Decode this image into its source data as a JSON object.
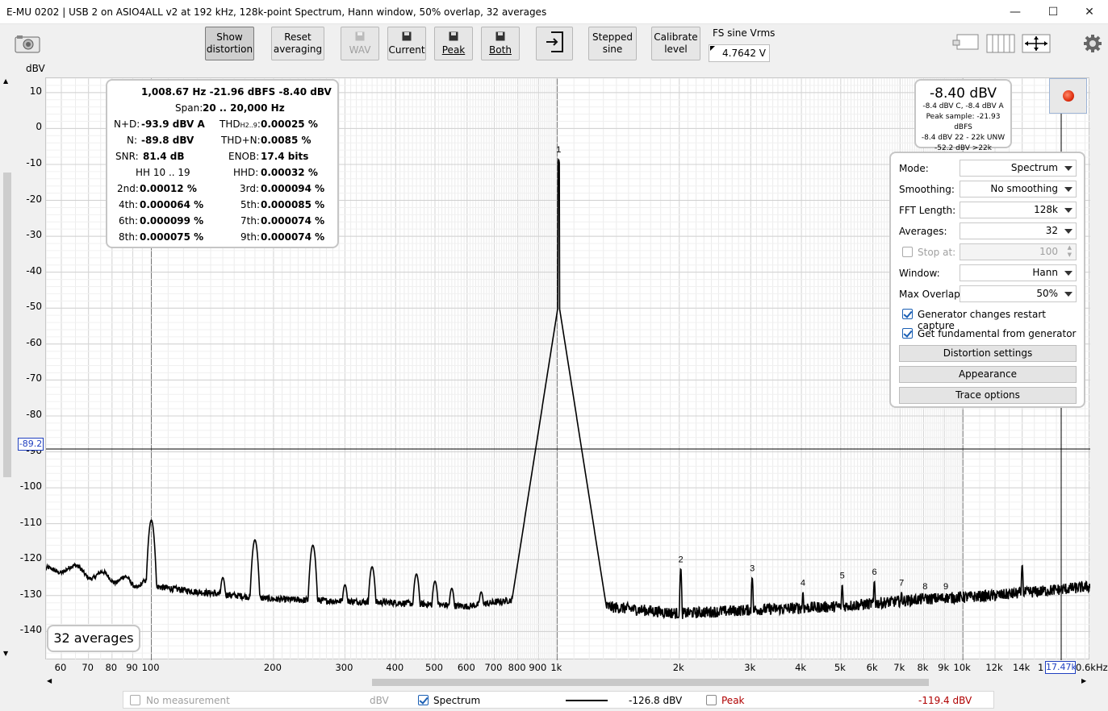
{
  "window": {
    "title": "E-MU 0202 | USB 2 on ASIO4ALL v2 at 192 kHz, 128k-point Spectrum, Hann window, 50% overlap, 32 averages",
    "minimize": "—",
    "maximize": "☐",
    "close": "✕"
  },
  "toolbar": {
    "show_distortion": [
      "Show",
      "distortion"
    ],
    "reset_averaging": [
      "Reset",
      "averaging"
    ],
    "wav": "WAV",
    "current": "Current",
    "peak": "Peak",
    "both": "Both",
    "stepped_sine": [
      "Stepped",
      "sine"
    ],
    "calibrate_level": [
      "Calibrate",
      "level"
    ],
    "fs_label": "FS sine Vrms",
    "fs_value": "4.7642 V"
  },
  "icons": {
    "camera": "camera-icon",
    "save": "save-icon",
    "export": "export-icon",
    "layout": "layout-icon",
    "columns": "columns-icon",
    "fit": "fit-arrows-icon",
    "gear": "gear-icon"
  },
  "info": {
    "header": "1,008.67 Hz  -21.96 dBFS  -8.40 dBV",
    "span_label": "Span:",
    "span_value": "20 .. 20,000 Hz",
    "nd_label": "N+D:",
    "nd_value": "-93.9 dBV A",
    "thd_label": "THD",
    "thd_sub": "H2..9",
    "thd_colon": ":",
    "thd_value": "0.00025 %",
    "n_label": "N:",
    "n_value": "-89.8 dBV",
    "thdn_label": "THD+N:",
    "thdn_value": "0.0085 %",
    "snr_label": "SNR:",
    "snr_value": "81.4 dB",
    "enob_label": "ENOB:",
    "enob_value": "17.4 bits",
    "hh_label": "HH 10 .. 19",
    "hhd_label": "HHD:",
    "hhd_value": "0.00032 %",
    "h2_label": "2nd:",
    "h2_value": "0.00012 %",
    "h3_label": "3rd:",
    "h3_value": "0.000094 %",
    "h4_label": "4th:",
    "h4_value": "0.000064 %",
    "h5_label": "5th:",
    "h5_value": "0.000085 %",
    "h6_label": "6th:",
    "h6_value": "0.000099 %",
    "h7_label": "7th:",
    "h7_value": "0.000074 %",
    "h8_label": "8th:",
    "h8_value": "0.000075 %",
    "h9_label": "9th:",
    "h9_value": "0.000074 %"
  },
  "level": {
    "main": "-8.40 dBV",
    "line1": "-8.4 dBV C, -8.4 dBV A",
    "line2": "Peak sample: -21.93 dBFS",
    "line3": "-8.4 dBV 22 - 22k UNW",
    "line4": "-52.2 dBV >22k"
  },
  "settings": {
    "mode_label": "Mode:",
    "mode_value": "Spectrum",
    "smoothing_label": "Smoothing:",
    "smoothing_value": "No smoothing",
    "fft_label": "FFT Length:",
    "fft_value": "128k",
    "averages_label": "Averages:",
    "averages_value": "32",
    "stop_label": "Stop at:",
    "stop_value": "100",
    "window_label": "Window:",
    "window_value": "Hann",
    "overlap_label": "Max Overlap:",
    "overlap_value": "50%",
    "gen_restart": "Generator changes restart capture",
    "get_fund": "Get fundamental from generator",
    "distortion_settings": "Distortion settings",
    "appearance": "Appearance",
    "trace_options": "Trace options"
  },
  "plot": {
    "y_unit": "dBV",
    "averages_badge": "32 averages",
    "cursor_y": "-89.2",
    "cursor_x": "17.47k",
    "x_tail_label": "0.6kHz",
    "x_partial_label": "1"
  },
  "legend": {
    "no_measurement": "No measurement",
    "unit": "dBV",
    "spectrum": "Spectrum",
    "spectrum_value": "-126.8 dBV",
    "peak": "Peak",
    "peak_value": "-119.4 dBV"
  },
  "chart_data": {
    "type": "line",
    "xscale": "log",
    "xlim": [
      55,
      20600
    ],
    "ylim": [
      -148,
      14
    ],
    "ylabel": "dBV",
    "y_ticks": [
      10,
      0,
      -10,
      -20,
      -30,
      -40,
      -50,
      -60,
      -70,
      -80,
      -90,
      -100,
      -110,
      -120,
      -130,
      -140
    ],
    "x_ticks": [
      {
        "v": 60,
        "t": "60"
      },
      {
        "v": 70,
        "t": "70"
      },
      {
        "v": 80,
        "t": "80"
      },
      {
        "v": 90,
        "t": "90"
      },
      {
        "v": 100,
        "t": "100"
      },
      {
        "v": 200,
        "t": "200"
      },
      {
        "v": 300,
        "t": "300"
      },
      {
        "v": 400,
        "t": "400"
      },
      {
        "v": 500,
        "t": "500"
      },
      {
        "v": 600,
        "t": "600"
      },
      {
        "v": 700,
        "t": "700"
      },
      {
        "v": 800,
        "t": "800"
      },
      {
        "v": 900,
        "t": "900"
      },
      {
        "v": 1000,
        "t": "1k"
      },
      {
        "v": 2000,
        "t": "2k"
      },
      {
        "v": 3000,
        "t": "3k"
      },
      {
        "v": 4000,
        "t": "4k"
      },
      {
        "v": 5000,
        "t": "5k"
      },
      {
        "v": 6000,
        "t": "6k"
      },
      {
        "v": 7000,
        "t": "7k"
      },
      {
        "v": 8000,
        "t": "8k"
      },
      {
        "v": 9000,
        "t": "9k"
      },
      {
        "v": 10000,
        "t": "10k"
      },
      {
        "v": 12000,
        "t": "12k"
      },
      {
        "v": 14000,
        "t": "14k"
      }
    ],
    "series": [
      {
        "name": "Spectrum",
        "color": "#000000",
        "floor": [
          [
            55,
            -123.5
          ],
          [
            62,
            -122
          ],
          [
            70,
            -124
          ],
          [
            80,
            -125
          ],
          [
            95,
            -127
          ],
          [
            130,
            -129
          ],
          [
            200,
            -131
          ],
          [
            400,
            -132
          ],
          [
            600,
            -133
          ],
          [
            800,
            -131
          ],
          [
            900,
            -128
          ],
          [
            1300,
            -133
          ],
          [
            2000,
            -135
          ],
          [
            3000,
            -134
          ],
          [
            5000,
            -133
          ],
          [
            8000,
            -131
          ],
          [
            12000,
            -130
          ],
          [
            20600,
            -127.5
          ]
        ],
        "peaks": [
          {
            "f": 100,
            "db": -109
          },
          {
            "f": 150,
            "db": -125
          },
          {
            "f": 180,
            "db": -114.5
          },
          {
            "f": 250,
            "db": -116
          },
          {
            "f": 300,
            "db": -127
          },
          {
            "f": 350,
            "db": -122
          },
          {
            "f": 450,
            "db": -124
          },
          {
            "f": 500,
            "db": -126
          },
          {
            "f": 550,
            "db": -128
          },
          {
            "f": 650,
            "db": -129
          },
          {
            "f": 2017,
            "db": -122.5
          },
          {
            "f": 3026,
            "db": -125
          },
          {
            "f": 4035,
            "db": -129
          },
          {
            "f": 5043,
            "db": -127
          },
          {
            "f": 6052,
            "db": -126
          },
          {
            "f": 7061,
            "db": -129
          },
          {
            "f": 8069,
            "db": -130
          },
          {
            "f": 9078,
            "db": -130
          },
          {
            "f": 14000,
            "db": -121.5
          }
        ],
        "fundamental": {
          "f": 1008.67,
          "db": -8.4
        }
      }
    ],
    "harmonic_markers": [
      {
        "n": "1",
        "f": 1008.67,
        "db": -8.4
      },
      {
        "n": "2",
        "f": 2017,
        "db": -122.5
      },
      {
        "n": "3",
        "f": 3026,
        "db": -125
      },
      {
        "n": "4",
        "f": 4035,
        "db": -129
      },
      {
        "n": "5",
        "f": 5043,
        "db": -127
      },
      {
        "n": "6",
        "f": 6052,
        "db": -126
      },
      {
        "n": "7",
        "f": 7061,
        "db": -129
      },
      {
        "n": "8",
        "f": 8069,
        "db": -130
      },
      {
        "n": "9",
        "f": 9078,
        "db": -130
      }
    ],
    "cursor": {
      "x": 17470,
      "y": -89.2
    }
  }
}
